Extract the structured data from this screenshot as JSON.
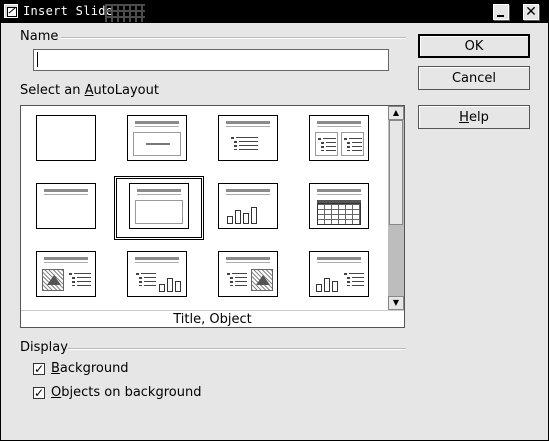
{
  "window": {
    "title": "Insert Slide",
    "minimize_label": "_",
    "close_label": "✕"
  },
  "name_group": {
    "label": "Name",
    "value": ""
  },
  "autolayout_group": {
    "label_prefix": "Select an ",
    "label_mnemonic": "A",
    "label_suffix": "utoLayout",
    "selected_caption": "Title, Object",
    "selected_index": 5,
    "layouts": [
      {
        "id": "blank-slide"
      },
      {
        "id": "title-slide"
      },
      {
        "id": "title-text"
      },
      {
        "id": "title-2-text"
      },
      {
        "id": "title-only"
      },
      {
        "id": "title-object"
      },
      {
        "id": "title-chart"
      },
      {
        "id": "title-table"
      },
      {
        "id": "title-clipart-text"
      },
      {
        "id": "title-text-chart"
      },
      {
        "id": "title-text-clipart"
      },
      {
        "id": "title-chart-text"
      }
    ]
  },
  "buttons": {
    "ok": "OK",
    "cancel": "Cancel",
    "help_mnemonic": "H",
    "help_suffix": "elp"
  },
  "display_group": {
    "label": "Display",
    "background": {
      "mnemonic": "B",
      "suffix": "ackground",
      "checked": true
    },
    "objects_on_background": {
      "mnemonic": "O",
      "suffix": "bjects on background",
      "checked": true
    }
  },
  "icons": {
    "system_menu": "system-menu-icon",
    "minimize": "minimize-icon",
    "close": "close-icon",
    "scroll_up": "scroll-up-arrow-icon",
    "scroll_down": "scroll-down-arrow-icon",
    "check": "checkmark-icon"
  }
}
